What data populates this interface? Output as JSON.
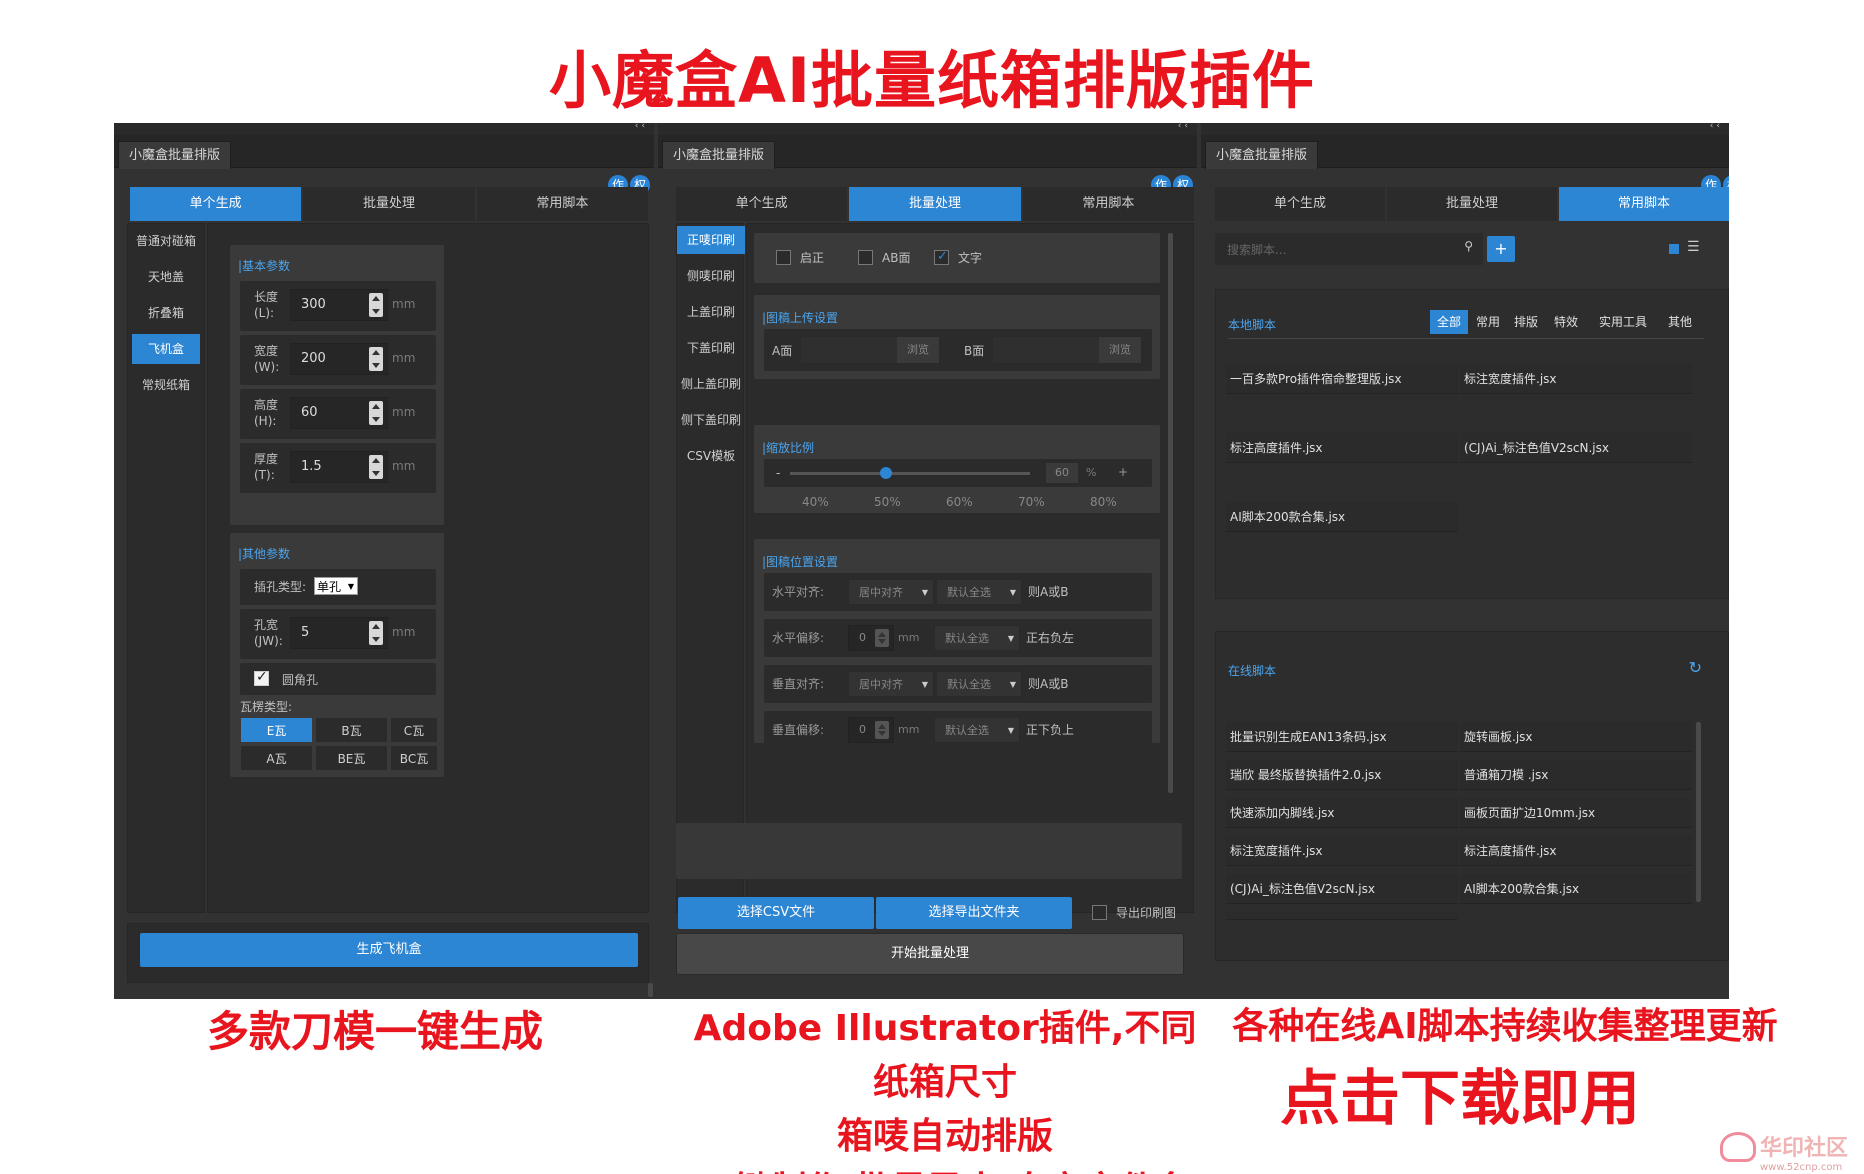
{
  "promo": {
    "title": "小魔盒AI批量纸箱排版插件",
    "caption_left": "多款刀模一键生成",
    "caption_mid_1": "Adobe Illustrator插件,不同纸箱尺寸",
    "caption_mid_2": "箱唛自动排版",
    "caption_mid_3": "一键制作  批量导出  自定文件名",
    "caption_right_1": "各种在线AI脚本持续收集整理更新",
    "caption_right_2": "点击下载即用",
    "watermark": "华印社区",
    "watermark_url": "www.52cnp.com"
  },
  "common": {
    "panel_title": "小魔盒批量排版",
    "badge_1": "作",
    "badge_2": "权",
    "tabs": [
      "单个生成",
      "批量处理",
      "常用脚本"
    ],
    "collapse_glyph": "‹‹"
  },
  "panel1": {
    "sidebar": [
      "普通对碰箱",
      "天地盖",
      "折叠箱",
      "飞机盒",
      "常规纸箱"
    ],
    "active_sidebar_index": 3,
    "basic_title": "|基本参数",
    "fields": [
      {
        "label1": "长度",
        "label2": "(L):",
        "value": "300",
        "unit": "mm"
      },
      {
        "label1": "宽度",
        "label2": "(W):",
        "value": "200",
        "unit": "mm"
      },
      {
        "label1": "高度",
        "label2": "(H):",
        "value": "60",
        "unit": "mm"
      },
      {
        "label1": "厚度",
        "label2": "(T):",
        "value": "1.5",
        "unit": "mm"
      }
    ],
    "other_title": "|其他参数",
    "hole_type_label": "插孔类型:",
    "hole_type_value": "单孔",
    "hole_width": {
      "label1": "孔宽",
      "label2": "(JW):",
      "value": "5",
      "unit": "mm"
    },
    "round_hole_label": "圆角孔",
    "flute_label": "瓦楞类型:",
    "flutes": [
      "E瓦",
      "B瓦",
      "C瓦",
      "A瓦",
      "BE瓦",
      "BC瓦"
    ],
    "generate_button": "生成飞机盒"
  },
  "panel2": {
    "sidebar": [
      "正唛印刷",
      "侧唛印刷",
      "上盖印刷",
      "下盖印刷",
      "侧上盖印刷",
      "侧下盖印刷",
      "CSV模板"
    ],
    "options": [
      "启正",
      "AB面",
      "文字"
    ],
    "upload_title": "|图稿上传设置",
    "a_label": "A面",
    "b_label": "B面",
    "browse": "浏览",
    "scale_title": "|缩放比例",
    "scale_value": "60",
    "scale_unit": "%",
    "scale_fraction": 0.4,
    "scale_ticks": [
      "40%",
      "50%",
      "60%",
      "70%",
      "80%"
    ],
    "minus": "-",
    "plus": "+",
    "position_title": "|图稿位置设置",
    "pos_rows": [
      {
        "label": "水平对齐:",
        "dd1": "居中对齐",
        "dd2": "默认全选",
        "tail": "则A或B"
      },
      {
        "label": "水平偏移:",
        "num": "0",
        "unit": "mm",
        "dd2": "默认全选",
        "tail": "正右负左"
      },
      {
        "label": "垂直对齐:",
        "dd1": "居中对齐",
        "dd2": "默认全选",
        "tail": "则A或B"
      },
      {
        "label": "垂直偏移:",
        "num": "0",
        "unit": "mm",
        "dd2": "默认全选",
        "tail": "正下负上"
      }
    ],
    "btn_csv": "选择CSV文件",
    "btn_export_folder": "选择导出文件夹",
    "export_preview_label": "导出印刷图",
    "start_button": "开始批量处理"
  },
  "panel3": {
    "search_placeholder": "搜索脚本...",
    "add": "+",
    "local_title": "本地脚本",
    "filters": [
      "全部",
      "常用",
      "排版",
      "特效",
      "实用工具",
      "其他"
    ],
    "local_scripts": [
      "一百多款Pro插件宿命整理版.jsx",
      "标注宽度插件.jsx",
      "标注高度插件.jsx",
      "(CJ)Ai_标注色值V2scN.jsx",
      "AI脚本200款合集.jsx"
    ],
    "online_title": "在线脚本",
    "refresh": "↻",
    "online_scripts": [
      "批量识别生成EAN13条码.jsx",
      "旋转画板.jsx",
      "瑞欣 最终版替换插件2.0.jsx",
      "普通箱刀模 .jsx",
      "快速添加内脚线.jsx",
      "画板页面扩边10mm.jsx",
      "标注宽度插件.jsx",
      "标注高度插件.jsx",
      "(CJ)Ai_标注色值V2scN.jsx",
      "AI脚本200款合集.jsx"
    ]
  },
  "colors": {
    "accent": "#2d86d3",
    "promo_red": "#e8141e",
    "panel_bg": "#323232"
  }
}
